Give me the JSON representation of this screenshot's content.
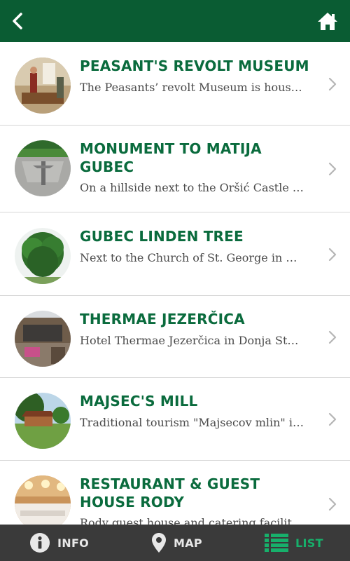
{
  "header": {
    "back_icon": "chevron-left-icon",
    "home_icon": "home-icon"
  },
  "items": [
    {
      "title": "PEASANT'S REVOLT MUSEUM",
      "description": "The Peasants’ revolt Museum is house..."
    },
    {
      "title": "MONUMENT TO MATIJA GUBEC",
      "description": "On a hillside next to the Oršić Castle i..."
    },
    {
      "title": "GUBEC LINDEN TREE",
      "description": "Next to the Church of St. George in G..."
    },
    {
      "title": "THERMAE JEZERČICA",
      "description": "Hotel Thermae Jezerčica in Donja Stu..."
    },
    {
      "title": "MAJSEC'S MILL",
      "description": "Traditional tourism \"Majsecov mlin\" is..."
    },
    {
      "title": "RESTAURANT & GUEST HOUSE RODY",
      "description": "Rody guest house and catering facility..."
    }
  ],
  "tabs": [
    {
      "label": "INFO",
      "icon": "info-icon",
      "active": false
    },
    {
      "label": "MAP",
      "icon": "map-pin-icon",
      "active": false
    },
    {
      "label": "LIST",
      "icon": "list-icon",
      "active": true
    }
  ],
  "colors": {
    "header_bg": "#0a5c33",
    "title": "#0a6b3d",
    "tabbar_bg": "#3a3a3a",
    "tab_active": "#17b06b"
  }
}
